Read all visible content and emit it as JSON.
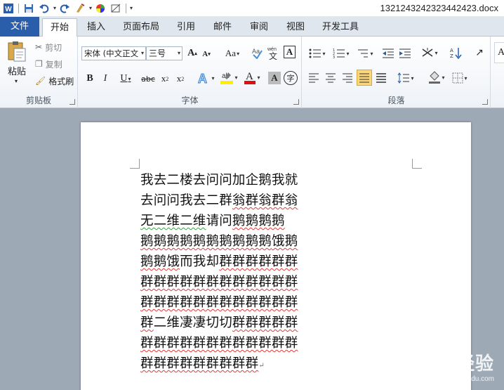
{
  "window": {
    "title": "1321243242323442423.docx"
  },
  "tabs": {
    "file": "文件",
    "home": "开始",
    "insert": "插入",
    "layout": "页面布局",
    "references": "引用",
    "mailings": "邮件",
    "review": "审阅",
    "view": "视图",
    "developer": "开发工具"
  },
  "clipboard": {
    "label": "剪贴板",
    "paste": "粘贴",
    "cut": "剪切",
    "copy": "复制",
    "format_painter": "格式刷"
  },
  "font": {
    "label": "字体",
    "name": "宋体 (中文正文",
    "size": "三号"
  },
  "paragraph": {
    "label": "段落"
  },
  "document": {
    "lines": [
      [
        {
          "t": "我去二楼去问问加企鹅我就",
          "c": ""
        }
      ],
      [
        {
          "t": "去问问我去二群",
          "c": ""
        },
        {
          "t": "翁群翁群翁",
          "c": "err"
        }
      ],
      [
        {
          "t": "无二维二维",
          "c": "grm"
        },
        {
          "t": "请问",
          "c": ""
        },
        {
          "t": "鹅鹅鹅鹅",
          "c": "err"
        }
      ],
      [
        {
          "t": "鹅鹅鹅鹅鹅鹅鹅鹅鹅鹅",
          "c": "err"
        },
        {
          "t": "饿鹅",
          "c": "err"
        }
      ],
      [
        {
          "t": "鹅鹅饿",
          "c": "err"
        },
        {
          "t": "而我却",
          "c": ""
        },
        {
          "t": "群群群群群群",
          "c": "err"
        }
      ],
      [
        {
          "t": "群群群群群群群群群群群群",
          "c": "err"
        }
      ],
      [
        {
          "t": "群群群群群群群群群群群群",
          "c": "err"
        }
      ],
      [
        {
          "t": "群",
          "c": "err"
        },
        {
          "t": "二维凄凄切切",
          "c": ""
        },
        {
          "t": "群群群群群",
          "c": "err"
        }
      ],
      [
        {
          "t": "群群群群群群群群群群群群",
          "c": "err"
        }
      ],
      [
        {
          "t": "群群群群群群群群群",
          "c": "err"
        }
      ]
    ]
  },
  "watermark": {
    "brand": "Bai 经验",
    "url": "jingyan.baidu.com"
  },
  "colors": {
    "file_tab": "#2a5eaa",
    "doc_bg": "#9ea9b6",
    "spell_error": "#e03a3a",
    "grammar_error": "#3fa24a"
  }
}
